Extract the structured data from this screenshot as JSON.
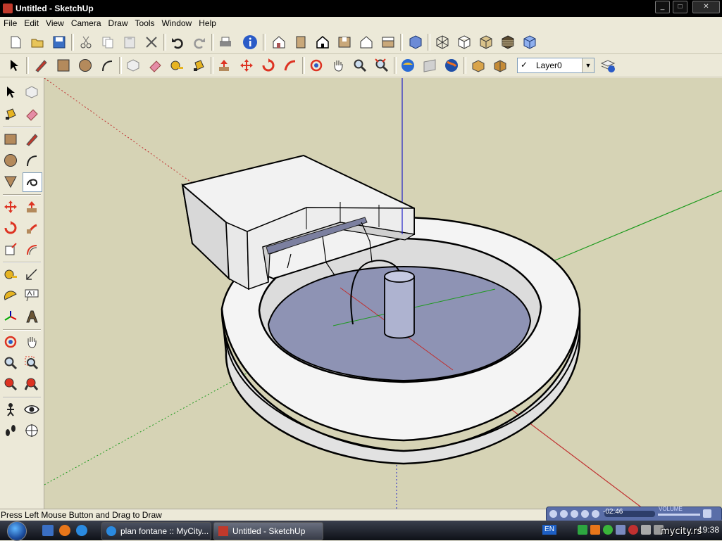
{
  "window": {
    "title": "Untitled - SketchUp",
    "minimize": "_",
    "maximize": "□",
    "close": "✕"
  },
  "menu": [
    "File",
    "Edit",
    "View",
    "Camera",
    "Draw",
    "Tools",
    "Window",
    "Help"
  ],
  "toolbar": {
    "layer_check": "✓",
    "layer_value": "Layer0",
    "layer_arrow": "▼"
  },
  "status": {
    "text": "Press Left Mouse Button and Drag to Draw"
  },
  "player": {
    "time": "-02:46",
    "volume_label": "VOLUME"
  },
  "taskbar": {
    "tasks": [
      {
        "label": "plan fontane :: MyCity..."
      },
      {
        "label": "Untitled - SketchUp"
      }
    ],
    "lang": "EN",
    "clock": "19:38"
  },
  "watermark": "mycity.rs",
  "colors": {
    "sky": "#d6d3b5",
    "water": "#8e93b4",
    "axis_red": "#cc0000",
    "axis_green": "#00aa00",
    "axis_blue": "#0000cc"
  }
}
